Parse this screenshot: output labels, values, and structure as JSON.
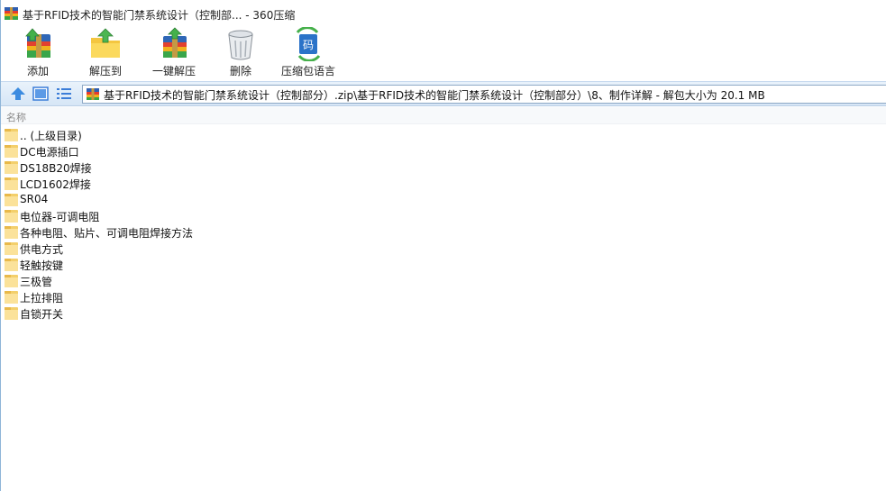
{
  "window": {
    "title": "基于RFID技术的智能门禁系统设计（控制部... - 360压缩"
  },
  "toolbar": {
    "buttons": [
      {
        "label": "添加",
        "icon": "add-archive-icon"
      },
      {
        "label": "解压到",
        "icon": "extract-to-icon"
      },
      {
        "label": "一键解压",
        "icon": "one-click-extract-icon"
      },
      {
        "label": "删除",
        "icon": "trash-icon"
      },
      {
        "label": "压缩包语言",
        "icon": "archive-language-icon"
      }
    ]
  },
  "address": {
    "path": "基于RFID技术的智能门禁系统设计（控制部分）.zip\\基于RFID技术的智能门禁系统设计（控制部分）\\8、制作详解 - 解包大小为 20.1 MB"
  },
  "list": {
    "column_name": "名称",
    "items": [
      ".. (上级目录)",
      "DC电源插口",
      "DS18B20焊接",
      "LCD1602焊接",
      "SR04",
      "电位器-可调电阻",
      "各种电阻、贴片、可调电阻焊接方法",
      "供电方式",
      "轻触按键",
      "三极管",
      "上拉排阻",
      "自锁开关"
    ]
  },
  "colors": {
    "folder": "#f3cf6b",
    "addressbar": "#d6e6f6",
    "accent": "#3b7dd8"
  }
}
